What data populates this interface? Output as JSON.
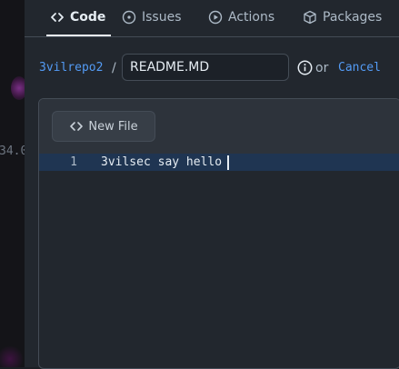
{
  "background": {
    "partial_text": "34.0"
  },
  "tabs": [
    {
      "label": "Code",
      "icon": "code-icon",
      "active": true
    },
    {
      "label": "Issues",
      "icon": "issue-opened-icon",
      "active": false
    },
    {
      "label": "Actions",
      "icon": "play-icon",
      "active": false
    },
    {
      "label": "Packages",
      "icon": "package-icon",
      "active": false
    }
  ],
  "breadcrumb": {
    "repo": "3vilrepo2",
    "separator": "/"
  },
  "filename_input": {
    "value": "README.MD"
  },
  "actions": {
    "or_text": "or",
    "cancel_label": "Cancel"
  },
  "editor": {
    "new_file_label": "New File",
    "lines": [
      {
        "number": "1",
        "text": "3vilsec say hello"
      }
    ]
  },
  "colors": {
    "accent_link": "#539bf5",
    "active_line": "#1f3552",
    "background": "#22272e"
  }
}
